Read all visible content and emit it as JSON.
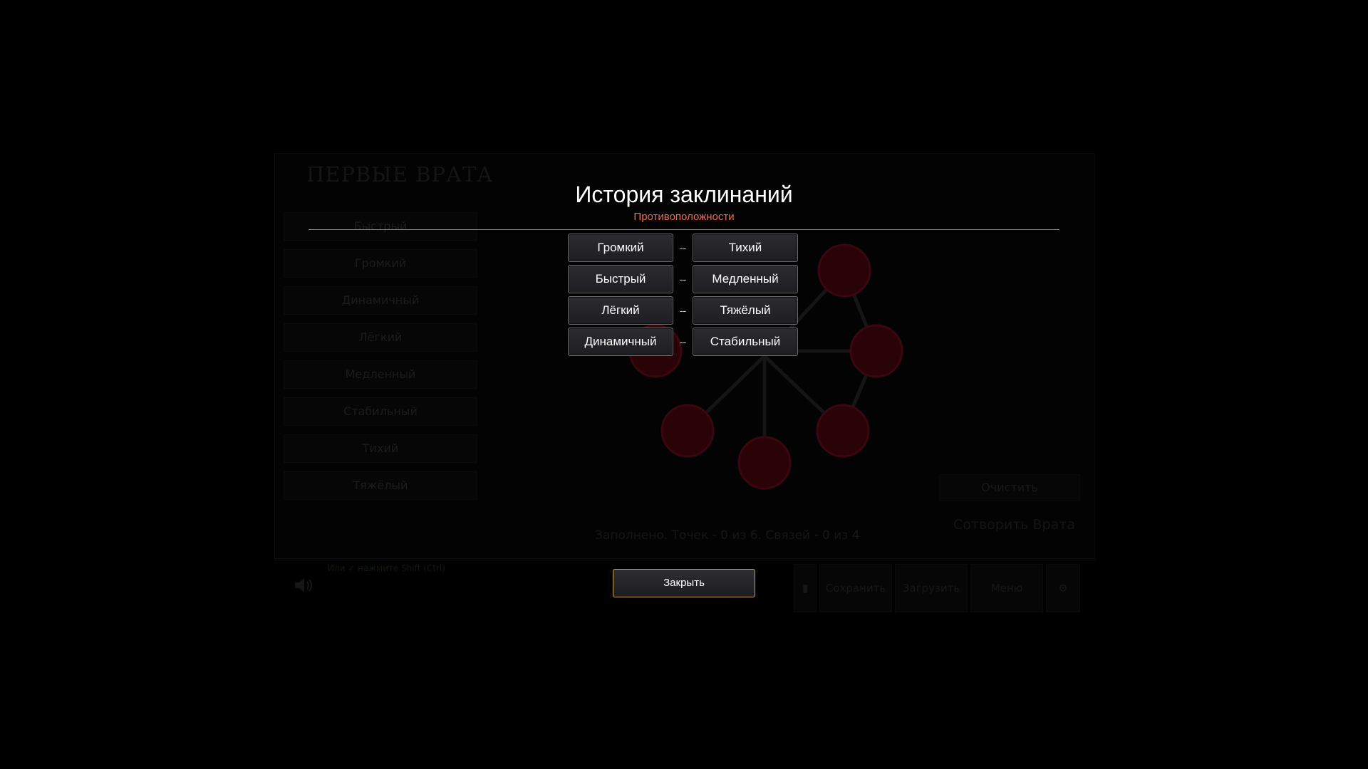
{
  "background": {
    "title": "ПЕРВЫЕ ВРАТА",
    "word_list": [
      "Быстрый",
      "Громкий",
      "Динамичный",
      "Лёгкий",
      "Медленный",
      "Стабильный",
      "Тихий",
      "Тяжёлый"
    ],
    "status": "Заполнено. Точек - 0 из 6. Связей - 0 из 4",
    "clear_label": "Очистить",
    "cast_label": "Сотворить Врата",
    "hint": "Или ✓ нажмите Shift (Ctrl)",
    "buttons": {
      "save": "Сохранить",
      "load": "Загрузить",
      "menu": "Меню"
    }
  },
  "modal": {
    "title": "История заклинаний",
    "subtitle": "Противоположности",
    "separator": "--",
    "pairs": [
      {
        "left": "Громкий",
        "right": "Тихий"
      },
      {
        "left": "Быстрый",
        "right": "Медленный"
      },
      {
        "left": "Лёгкий",
        "right": "Тяжёлый"
      },
      {
        "left": "Динамичный",
        "right": "Стабильный"
      }
    ],
    "close_label": "Закрыть"
  },
  "colors": {
    "subtitle": "#ee6a55",
    "close_border": "#c3a458",
    "rune_nodes": "#3a0610"
  }
}
